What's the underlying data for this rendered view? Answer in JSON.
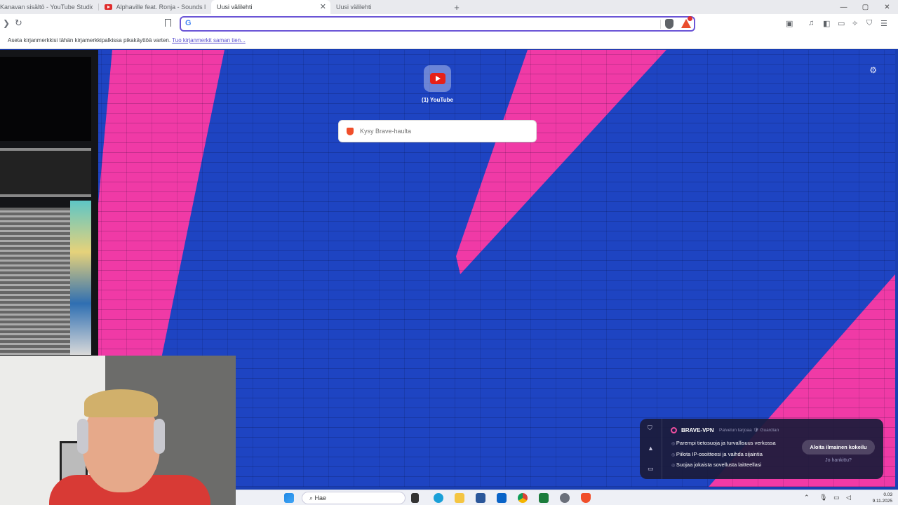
{
  "tabs": [
    {
      "title": "Kanavan sisältö - YouTube Studio"
    },
    {
      "title": "Alphaville feat. Ronja - Sounds like a"
    },
    {
      "title": "Uusi välilehti"
    },
    {
      "title": "Uusi välilehti"
    }
  ],
  "window_controls": {
    "minimize": "—",
    "maximize": "▢",
    "close": "✕"
  },
  "omnibox": {
    "value": "",
    "search_engine_glyph": "G"
  },
  "bookmarks_bar": {
    "text": "Aseta kirjanmerkkisi tähän kirjamerkkipalkissa pikakäyttöä varten.",
    "link": "Tuo kirjanmerkit saman tien..."
  },
  "new_tab": {
    "top_site_label": "(1) YouTube",
    "search_placeholder": "Kysy Brave-haulta"
  },
  "vpn_panel": {
    "title": "BRAVE-VPN",
    "provider": "Palvelun tarjoaa 🛡 Guardian",
    "features": [
      "Parempi tietosuoja ja turvallisuus verkossa",
      "Piilota IP-osoitteesi ja vaihda sijaintia",
      "Suojaa jokaista sovellusta laitteellasi"
    ],
    "cta_label": "Aloita ilmainen kokeilu",
    "already_label": "Jo hankittu?"
  },
  "taskbar": {
    "search_label": "Hae",
    "time": "0.03",
    "date": "9.11.2025"
  },
  "colors": {
    "accent": "#6b55d6",
    "wall_blue": "#1e44c2",
    "wall_pink": "#f03aa6",
    "youtube_red": "#e62117"
  }
}
